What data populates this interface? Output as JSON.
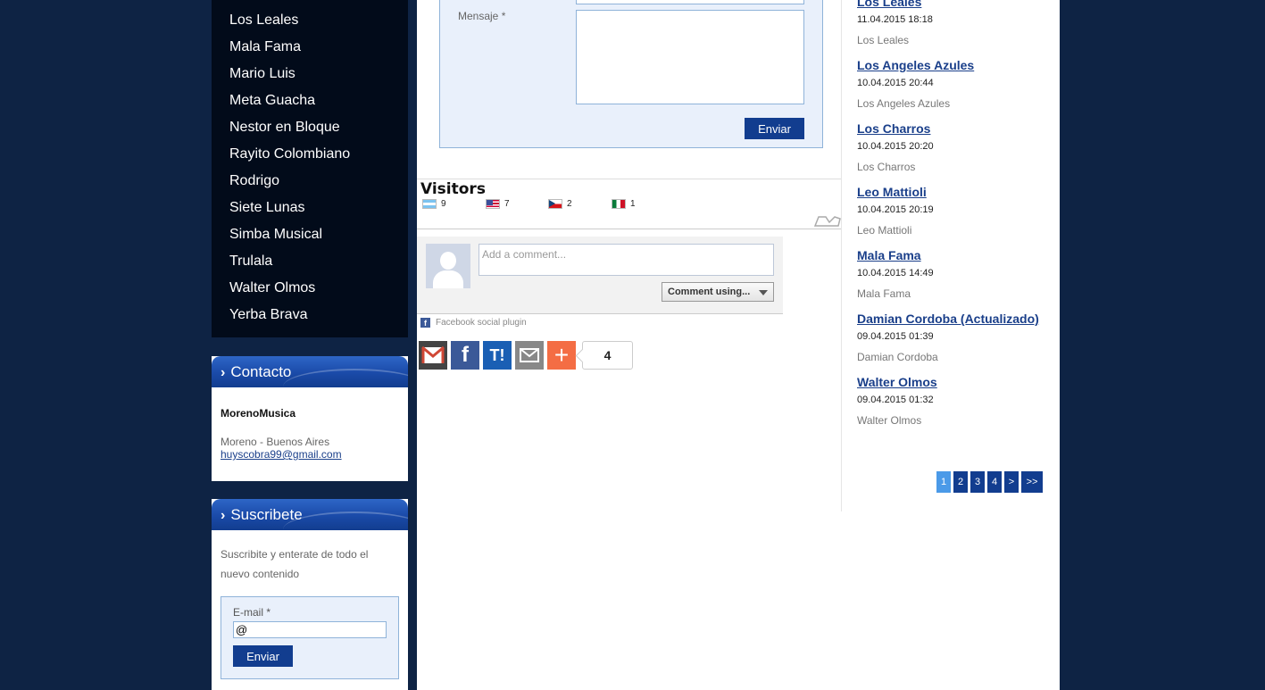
{
  "nav": {
    "items": [
      "Los Leales",
      "Mala Fama",
      "Mario Luis",
      "Meta Guacha",
      "Nestor en Bloque",
      "Rayito Colombiano",
      "Rodrigo",
      "Siete Lunas",
      "Simba Musical",
      "Trulala",
      "Walter Olmos",
      "Yerba Brava"
    ]
  },
  "contact": {
    "title": "Contacto",
    "name": "MorenoMusica",
    "location": "Moreno - Buenos Aires",
    "email": "huyscobra99@gmail.com"
  },
  "subscribe": {
    "title": "Suscribete",
    "text": "Suscribite y enterate de todo el nuevo contenido",
    "email_label": "E-mail *",
    "email_value": "@",
    "button": "Enviar"
  },
  "message_form": {
    "label": "Mensaje *",
    "button": "Enviar"
  },
  "visitors": {
    "title": "Visitors",
    "counts": [
      {
        "flag": "ar",
        "count": "9"
      },
      {
        "flag": "us",
        "count": "7"
      },
      {
        "flag": "cz",
        "count": "2"
      },
      {
        "flag": "mx",
        "count": "1"
      }
    ]
  },
  "facebook": {
    "placeholder": "Add a comment...",
    "comment_using": "Comment using...",
    "plugin_label": "Facebook social plugin"
  },
  "share": {
    "icons": [
      "gmail-icon",
      "facebook-icon",
      "tumblr-icon",
      "email-icon",
      "addthis-plus-icon"
    ],
    "count": "4"
  },
  "posts": [
    {
      "title": "Los Leales",
      "date": "11.04.2015 18:18",
      "author": "Los Leales"
    },
    {
      "title": "Los Angeles Azules",
      "date": "10.04.2015 20:44",
      "author": "Los Angeles Azules"
    },
    {
      "title": "Los Charros",
      "date": "10.04.2015 20:20",
      "author": "Los Charros"
    },
    {
      "title": "Leo Mattioli",
      "date": "10.04.2015 20:19",
      "author": "Leo Mattioli"
    },
    {
      "title": "Mala Fama",
      "date": "10.04.2015 14:49",
      "author": "Mala Fama"
    },
    {
      "title": "Damian Cordoba (Actualizado)",
      "date": "09.04.2015 01:39",
      "author": "Damian Cordoba"
    },
    {
      "title": "Walter Olmos",
      "date": "09.04.2015 01:32",
      "author": "Walter Olmos"
    }
  ],
  "pager": {
    "pages": [
      "1",
      "2",
      "3",
      "4",
      ">",
      ">>"
    ],
    "active": "1"
  },
  "colors": {
    "background": "#0e2344",
    "nav_bg": "#020b1a",
    "accent": "#123d8f",
    "link": "#1a3f8a",
    "pager_active": "#4b9ae8"
  }
}
